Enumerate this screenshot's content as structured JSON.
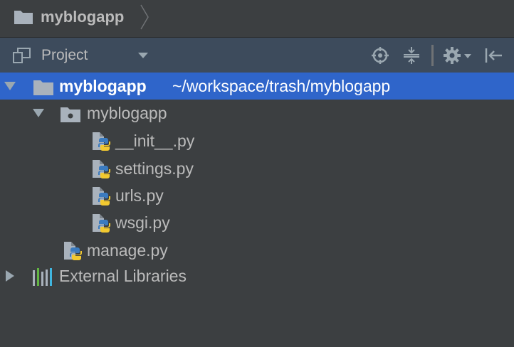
{
  "breadcrumb": {
    "project_name": "myblogapp"
  },
  "toolwindow": {
    "title": "Project",
    "icons": [
      "project-view-icon",
      "dropdown-arrow-icon",
      "locate-icon",
      "collapse-all-icon",
      "gear-icon",
      "hide-icon"
    ]
  },
  "tree": {
    "root": {
      "name": "myblogapp",
      "path": "~/workspace/trash/myblogapp"
    },
    "package": {
      "name": "myblogapp"
    },
    "files": [
      "__init__.py",
      "settings.py",
      "urls.py",
      "wsgi.py"
    ],
    "manage": "manage.py",
    "external": "External Libraries"
  },
  "colors": {
    "background": "#3c3f41",
    "header": "#3d4b5c",
    "selection": "#2f65ca",
    "text": "#bbbbbb"
  }
}
